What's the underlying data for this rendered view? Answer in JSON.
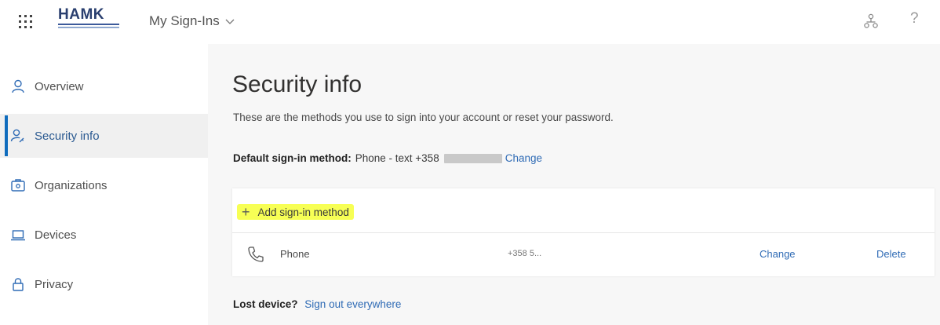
{
  "header": {
    "logo_text": "HAMK",
    "app_title": "My Sign-Ins",
    "help_label": "?"
  },
  "sidebar": {
    "items": [
      {
        "label": "Overview",
        "icon": "person-icon"
      },
      {
        "label": "Security info",
        "icon": "person-key-icon",
        "active": true
      },
      {
        "label": "Organizations",
        "icon": "briefcase-icon"
      },
      {
        "label": "Devices",
        "icon": "laptop-icon"
      },
      {
        "label": "Privacy",
        "icon": "lock-icon"
      }
    ]
  },
  "main": {
    "title": "Security info",
    "description": "These are the methods you use to sign into your account or reset your password.",
    "default_method": {
      "label": "Default sign-in method:",
      "value": "Phone - text +358",
      "change_link": "Change"
    },
    "add_method_label": "Add sign-in method",
    "methods": [
      {
        "name": "Phone",
        "value": "+358 5...",
        "change": "Change",
        "delete": "Delete"
      }
    ],
    "lost_device": {
      "label": "Lost device?",
      "link": "Sign out everywhere"
    }
  },
  "colors": {
    "accent": "#0f6cbd",
    "link": "#2f6bb5",
    "highlight": "#f7ff55",
    "main_bg": "#f7f7f7"
  }
}
